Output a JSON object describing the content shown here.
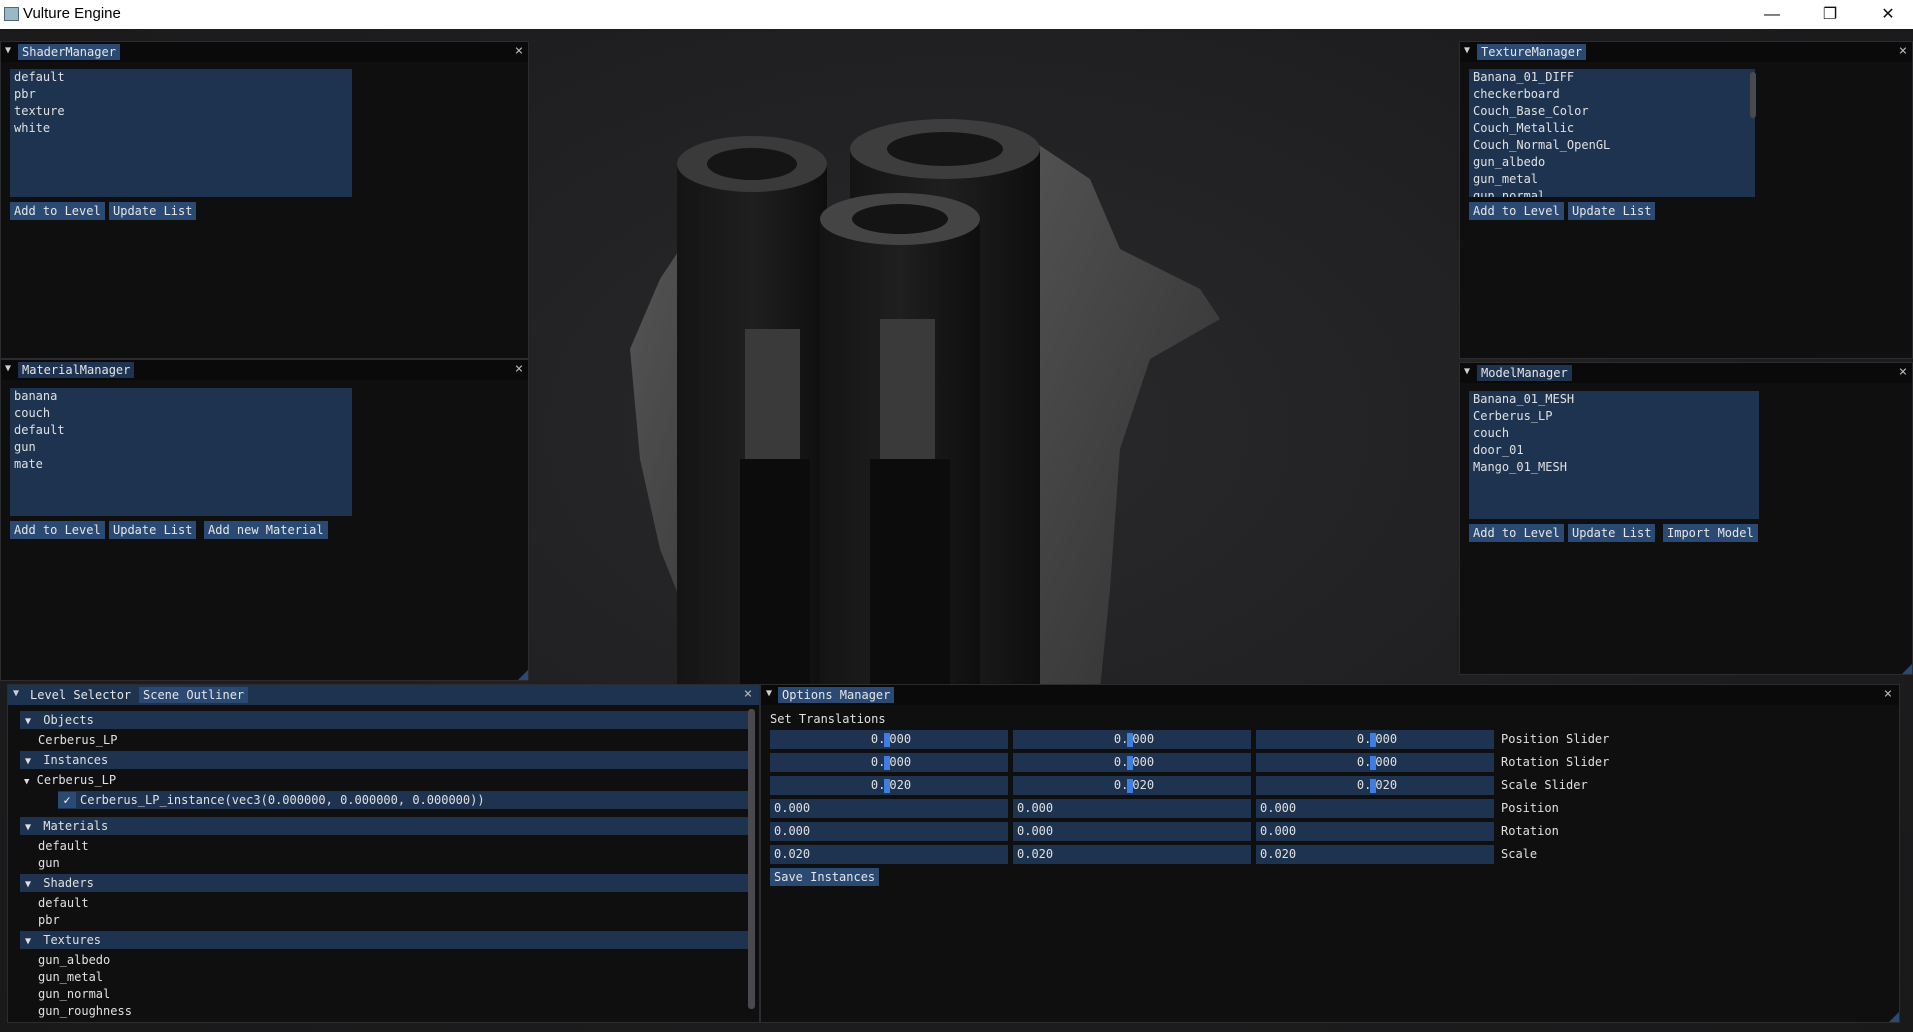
{
  "window": {
    "title": "Vulture Engine",
    "minimize": "—",
    "restore": "❐",
    "close": "✕"
  },
  "shader_manager": {
    "tab": "ShaderManager",
    "items": [
      "default",
      "pbr",
      "texture",
      "white"
    ],
    "buttons": [
      "Add to Level",
      "Update List"
    ]
  },
  "material_manager": {
    "tab": "MaterialManager",
    "items": [
      "banana",
      "couch",
      "default",
      "gun",
      "mate"
    ],
    "buttons": [
      "Add to Level",
      "Update List",
      "Add new Material"
    ]
  },
  "texture_manager": {
    "tab": "TextureManager",
    "items": [
      "Banana_01_DIFF",
      "checkerboard",
      "Couch_Base_Color",
      "Couch_Metallic",
      "Couch_Normal_OpenGL",
      "gun_albedo",
      "gun_metal",
      "gun_normal"
    ],
    "buttons": [
      "Add to Level",
      "Update List"
    ]
  },
  "model_manager": {
    "tab": "ModelManager",
    "items": [
      "Banana_01_MESH",
      "Cerberus_LP",
      "couch",
      "door_01",
      "Mango_01_MESH"
    ],
    "buttons": [
      "Add to Level",
      "Update List",
      "Import Model"
    ]
  },
  "level_panel": {
    "tabs": [
      "Level Selector",
      "Scene Outliner"
    ],
    "tree": {
      "objects_header": "Objects",
      "objects": [
        "Cerberus_LP"
      ],
      "instances_header": "Instances",
      "instance_group": "Cerberus_LP",
      "instance_item": "Cerberus_LP_instance(vec3(0.000000, 0.000000, 0.000000))",
      "materials_header": "Materials",
      "materials": [
        "default",
        "gun"
      ],
      "shaders_header": "Shaders",
      "shaders": [
        "default",
        "pbr"
      ],
      "textures_header": "Textures",
      "textures": [
        "gun_albedo",
        "gun_metal",
        "gun_normal",
        "gun_roughness"
      ]
    }
  },
  "options_manager": {
    "tab": "Options Manager",
    "heading": "Set Translations",
    "sliders": [
      {
        "label": "Position Slider",
        "pre": [
          "0.",
          "0.",
          "0."
        ],
        "post": [
          "000",
          "000",
          "000"
        ]
      },
      {
        "label": "Rotation Slider",
        "pre": [
          "0.",
          "0.",
          "0."
        ],
        "post": [
          "000",
          "000",
          "000"
        ]
      },
      {
        "label": "Scale Slider",
        "pre": [
          "0.",
          "0.",
          "0."
        ],
        "post": [
          "020",
          "020",
          "020"
        ]
      }
    ],
    "fields": [
      {
        "label": "Position",
        "values": [
          "0.000",
          "0.000",
          "0.000"
        ]
      },
      {
        "label": "Rotation",
        "values": [
          "0.000",
          "0.000",
          "0.000"
        ]
      },
      {
        "label": "Scale",
        "values": [
          "0.020",
          "0.020",
          "0.020"
        ]
      }
    ],
    "save_button": "Save Instances"
  }
}
